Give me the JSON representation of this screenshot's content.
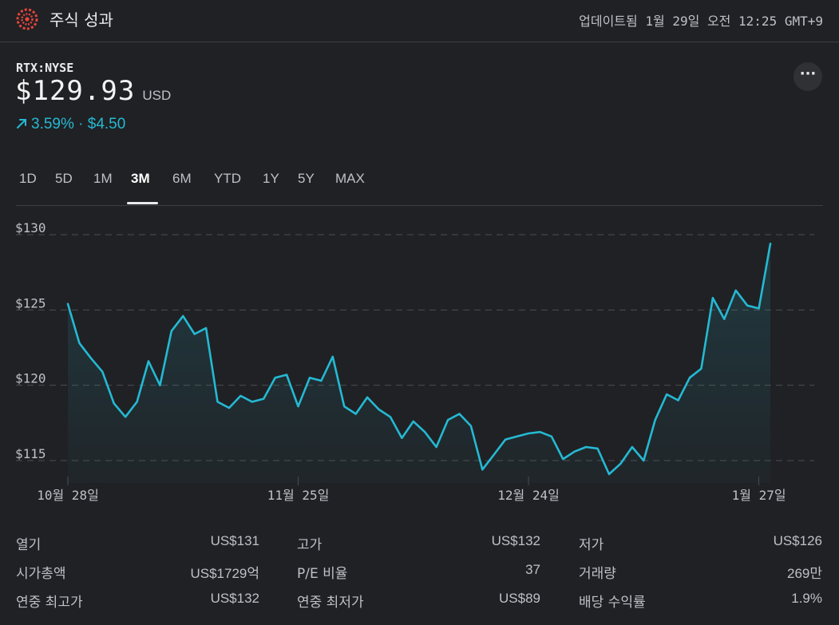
{
  "app": {
    "title": "주식 성과",
    "logo_icon": "finance-logo-icon",
    "updated": "업데이트됨 1월 29일 오전 12:25 GMT+9"
  },
  "quote": {
    "ticker": "RTX:NYSE",
    "price": "$129.93",
    "currency": "USD",
    "change_percent": "3.59%",
    "change_separator": "·",
    "change_amount": "$4.50",
    "change_icon": "trend-up-arrow-icon"
  },
  "more_button": {
    "label": "···",
    "icon": "more-horiz-icon"
  },
  "range_tabs": {
    "items": [
      "1D",
      "5D",
      "1M",
      "3M",
      "6M",
      "YTD",
      "1Y",
      "5Y",
      "MAX"
    ],
    "selected": "3M"
  },
  "colors": {
    "background": "#202124",
    "line": "#25b9d3",
    "positive": "#25b9d3",
    "grid": "#4a4d51",
    "text_secondary": "#bdc1c6"
  },
  "chart_data": {
    "type": "area",
    "y_tick_labels": [
      "$130",
      "$125",
      "$120",
      "$115"
    ],
    "y_ticks": [
      130,
      125,
      120,
      115
    ],
    "ylim": [
      113.2,
      131.9
    ],
    "x_ticks": [
      {
        "label": "10월 28일",
        "index": 0
      },
      {
        "label": "11월 25일",
        "index": 20
      },
      {
        "label": "12월 24일",
        "index": 40
      },
      {
        "label": "1월 27일",
        "index": 60
      }
    ],
    "values": [
      125.4,
      122.8,
      121.8,
      120.9,
      118.8,
      117.9,
      118.9,
      121.6,
      120.0,
      123.6,
      124.6,
      123.4,
      123.8,
      118.9,
      118.5,
      119.3,
      118.9,
      119.1,
      120.5,
      120.7,
      118.6,
      120.5,
      120.3,
      121.9,
      118.6,
      118.1,
      119.2,
      118.4,
      117.9,
      116.5,
      117.6,
      116.9,
      115.9,
      117.7,
      118.1,
      117.3,
      114.4,
      115.4,
      116.4,
      116.6,
      116.8,
      116.9,
      116.6,
      115.1,
      115.6,
      115.9,
      115.8,
      114.1,
      114.8,
      115.9,
      115.0,
      117.7,
      119.4,
      119.0,
      120.5,
      121.1,
      125.8,
      124.4,
      126.3,
      125.3,
      125.1,
      129.4
    ],
    "baseline_note": ""
  },
  "stats": [
    {
      "label": "열기",
      "value": "US$131"
    },
    {
      "label": "고가",
      "value": "US$132"
    },
    {
      "label": "저가",
      "value": "US$126"
    },
    {
      "label": "시가총액",
      "value": "US$1729억"
    },
    {
      "label": "P/E 비율",
      "value": "37"
    },
    {
      "label": "거래량",
      "value": "269만"
    },
    {
      "label": "연중 최고가",
      "value": "US$132"
    },
    {
      "label": "연중 최저가",
      "value": "US$89"
    },
    {
      "label": "배당 수익률",
      "value": "1.9%"
    }
  ]
}
